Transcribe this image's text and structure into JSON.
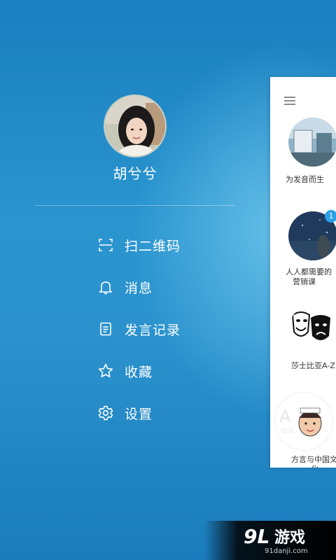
{
  "drawer": {
    "username": "胡兮兮",
    "menu": [
      {
        "label": "扫二维码",
        "icon": "scan-qr-icon"
      },
      {
        "label": "消息",
        "icon": "bell-icon"
      },
      {
        "label": "发言记录",
        "icon": "document-icon"
      },
      {
        "label": "收藏",
        "icon": "star-icon"
      },
      {
        "label": "设置",
        "icon": "gear-icon"
      }
    ]
  },
  "content": {
    "cards": [
      {
        "title": "为发音而生"
      },
      {
        "title": "人人都需要的",
        "title2": "营销课",
        "badge": "1"
      },
      {
        "title": "莎士比亚A-Z"
      },
      {
        "title": "方言与中国文",
        "title2": "化"
      }
    ]
  },
  "watermark": {
    "logo_text": "9L游戏",
    "url": "91danji.com"
  },
  "colors": {
    "drawer_bg": "#1b86c4",
    "panel_bg": "#ffffff",
    "badge": "#2aa0e6"
  }
}
